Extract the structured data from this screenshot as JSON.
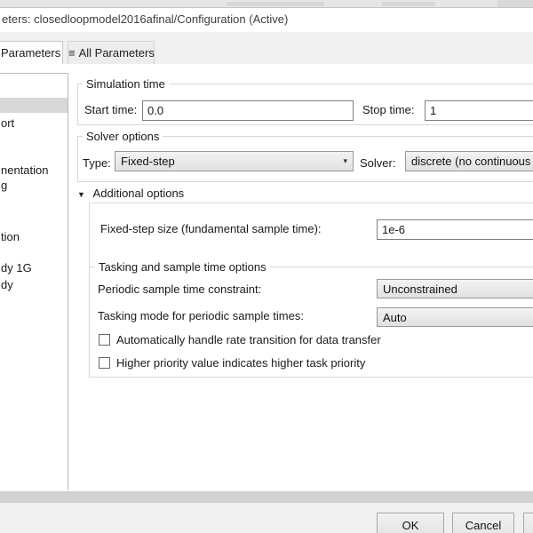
{
  "window": {
    "title": "eters: closedloopmodel2016afinal/Configuration (Active)"
  },
  "tabs": {
    "tab1_label": "Parameters",
    "tab2_label": "All Parameters",
    "tab2_icon": "≡"
  },
  "sidebar": {
    "items": [
      {
        "label": "ort"
      },
      {
        "label": "nentation"
      },
      {
        "label": "g"
      },
      {
        "label": "tion"
      },
      {
        "label": "dy 1G"
      },
      {
        "label": "dy"
      }
    ]
  },
  "simulation_time": {
    "title": "Simulation time",
    "start_label": "Start time:",
    "start_value": "0.0",
    "stop_label": "Stop time:",
    "stop_value": "1"
  },
  "solver_options": {
    "title": "Solver options",
    "type_label": "Type:",
    "type_value": "Fixed-step",
    "dropdown_arrow": "▾",
    "solver_label": "Solver:",
    "solver_value": "discrete (no continuous s"
  },
  "additional_options": {
    "collapse_icon": "▼",
    "title": "Additional options",
    "fixed_step_label": "Fixed-step size (fundamental sample time):",
    "fixed_step_value": "1e-6"
  },
  "tasking": {
    "title": "Tasking and sample time options",
    "periodic_label": "Periodic sample time constraint:",
    "periodic_value": "Unconstrained",
    "mode_label": "Tasking mode for periodic sample times:",
    "mode_value": "Auto",
    "check1_label": "Automatically handle rate transition for data transfer",
    "check1_checked": false,
    "check2_label": "Higher priority value indicates higher task priority",
    "check2_checked": false
  },
  "footer": {
    "ok_label": "OK",
    "cancel_label": "Cancel"
  },
  "colors": {
    "selection_gray": "#d8d8d8",
    "divider_band": "#d2d2d2",
    "footer_bg": "#f0f0f0",
    "combo_bg": "#e6e6e6"
  }
}
